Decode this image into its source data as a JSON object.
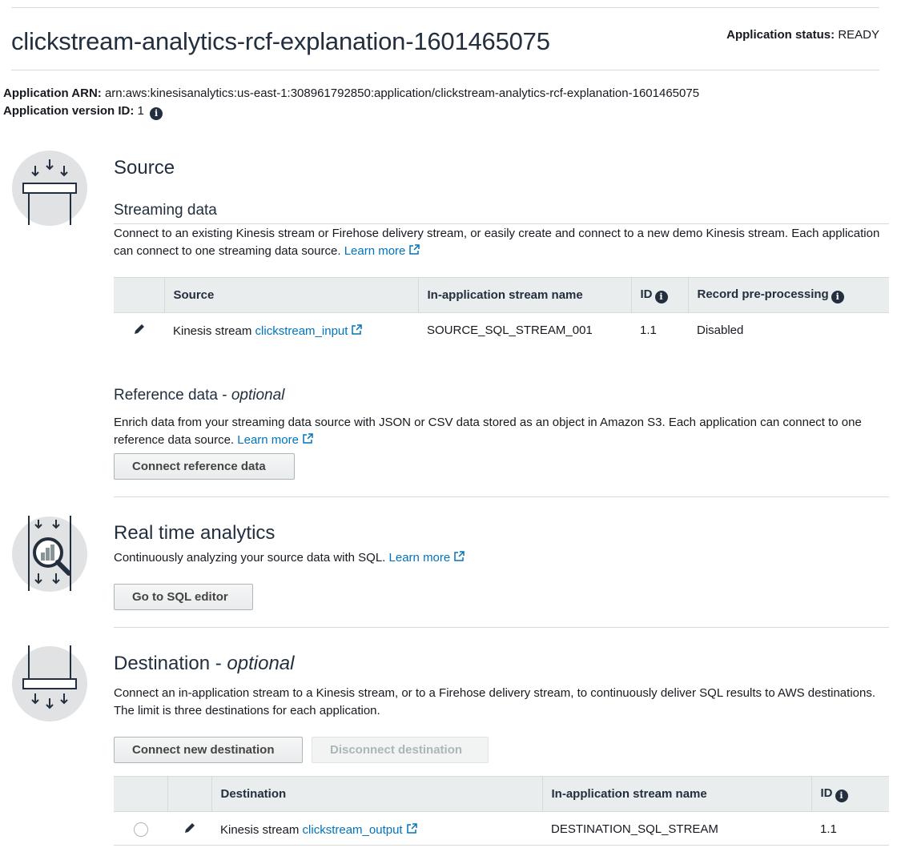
{
  "app": {
    "title": "clickstream-analytics-rcf-explanation-1601465075",
    "status_label": "Application status:",
    "status_value": "READY",
    "arn_label": "Application ARN:",
    "arn_value": "arn:aws:kinesisanalytics:us-east-1:308961792850:application/clickstream-analytics-rcf-explanation-1601465075",
    "version_label": "Application version ID:",
    "version_value": "1"
  },
  "source": {
    "heading": "Source",
    "streaming": {
      "heading": "Streaming data",
      "description": "Connect to an existing Kinesis stream or Firehose delivery stream, or easily create and connect to a new demo Kinesis stream. Each application can connect to one streaming data source.",
      "learn_more": "Learn more",
      "columns": [
        "Source",
        "In-application stream name",
        "ID",
        "Record pre-processing"
      ],
      "rows": [
        {
          "source_prefix": "Kinesis stream",
          "source_link": "clickstream_input",
          "stream_name": "SOURCE_SQL_STREAM_001",
          "id": "1.1",
          "preprocessing": "Disabled"
        }
      ]
    },
    "reference": {
      "heading": "Reference data -",
      "heading_optional": "optional",
      "description": "Enrich data from your streaming data source with JSON or CSV data stored as an object in Amazon S3. Each application can connect to one reference data source.",
      "learn_more": "Learn more",
      "button": "Connect reference data"
    }
  },
  "analytics": {
    "heading": "Real time analytics",
    "description": "Continuously analyzing your source data with SQL.",
    "learn_more": "Learn more",
    "button": "Go to SQL editor"
  },
  "destination": {
    "heading": "Destination -",
    "heading_optional": "optional",
    "description": "Connect an in-application stream to a Kinesis stream, or to a Firehose delivery stream, to continuously deliver SQL results to AWS destinations. The limit is three destinations for each application.",
    "connect_button": "Connect new destination",
    "disconnect_button": "Disconnect destination",
    "columns": [
      "Destination",
      "In-application stream name",
      "ID"
    ],
    "rows": [
      {
        "dest_prefix": "Kinesis stream",
        "dest_link": "clickstream_output",
        "stream_name": "DESTINATION_SQL_STREAM",
        "id": "1.1"
      }
    ]
  },
  "icons": [
    "source-icon",
    "analytics-icon",
    "destination-icon",
    "edit-pencil-icon",
    "external-link-icon",
    "info-icon"
  ]
}
